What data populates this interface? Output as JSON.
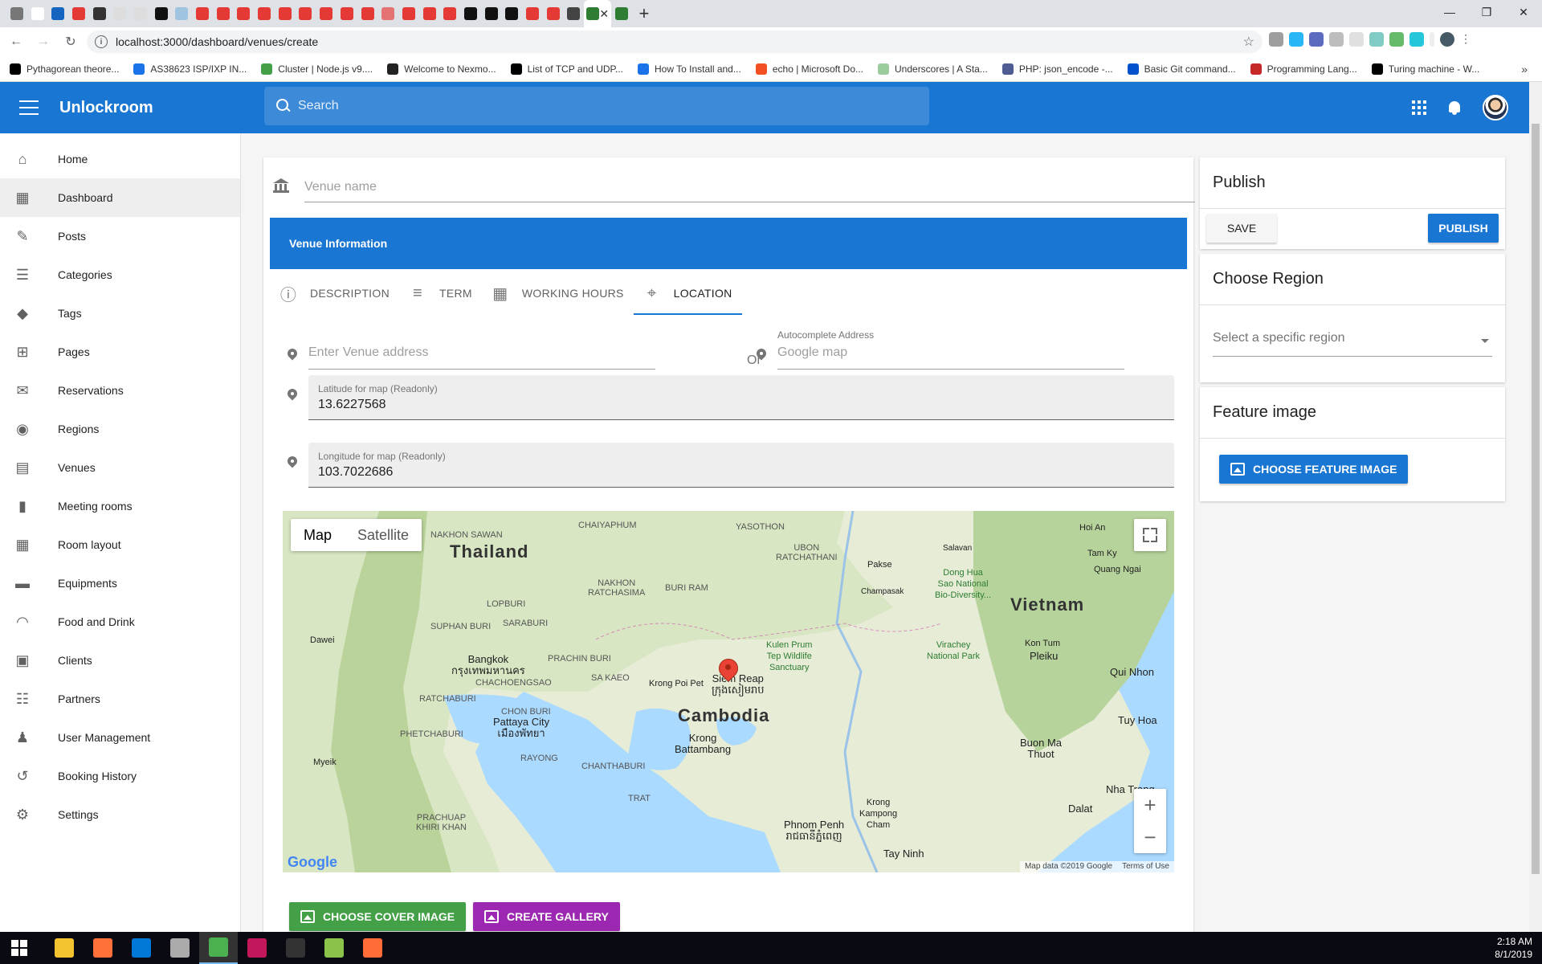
{
  "browser": {
    "url": "localhost:3000/dashboard/venues/create",
    "bookmarks": [
      {
        "label": "Pythagorean theore...",
        "icon": "wikipedia-icon",
        "color": "#000000"
      },
      {
        "label": "AS38623 ISP/IXP IN...",
        "icon": "pin-icon",
        "color": "#1a73e8"
      },
      {
        "label": "Cluster | Node.js v9....",
        "icon": "nodejs-icon",
        "color": "#43a047"
      },
      {
        "label": "Welcome to Nexmo...",
        "icon": "nexmo-icon",
        "color": "#222222"
      },
      {
        "label": "List of TCP and UDP...",
        "icon": "wikipedia-icon",
        "color": "#000000"
      },
      {
        "label": "How To Install and...",
        "icon": "digitalocean-icon",
        "color": "#1a73e8"
      },
      {
        "label": "echo | Microsoft Do...",
        "icon": "microsoft-icon",
        "color": "#f25022"
      },
      {
        "label": "Underscores | A Sta...",
        "icon": "underscores-icon",
        "color": "#9ccc9c"
      },
      {
        "label": "PHP: json_encode -...",
        "icon": "php-icon",
        "color": "#4f5b93"
      },
      {
        "label": "Basic Git command...",
        "icon": "atlassian-icon",
        "color": "#0052cc"
      },
      {
        "label": "Programming Lang...",
        "icon": "bookmark-icon",
        "color": "#c62828"
      },
      {
        "label": "Turing machine - W...",
        "icon": "wikipedia-icon",
        "color": "#000000"
      }
    ],
    "tab_favicons": [
      "#777777",
      "#ffffff",
      "#1565c0",
      "#e53935",
      "#333333",
      "#dddddd",
      "#dddddd",
      "#111111",
      "#a0c4e0",
      "#e53935",
      "#e53935",
      "#e53935",
      "#e53935",
      "#e53935",
      "#e53935",
      "#e53935",
      "#e53935",
      "#e53935",
      "#e57373",
      "#e53935",
      "#e53935",
      "#e53935",
      "#111111",
      "#111111",
      "#111111",
      "#e53935",
      "#e53935",
      "#444444",
      "#2e7d32"
    ]
  },
  "app": {
    "brand": "Unlockroom",
    "search_placeholder": "Search"
  },
  "sidebar": {
    "items": [
      {
        "label": "Home",
        "icon": "home-icon"
      },
      {
        "label": "Dashboard",
        "icon": "dashboard-icon",
        "active": true
      },
      {
        "label": "Posts",
        "icon": "pencil-icon"
      },
      {
        "label": "Categories",
        "icon": "list-icon"
      },
      {
        "label": "Tags",
        "icon": "tag-icon"
      },
      {
        "label": "Pages",
        "icon": "add-page-icon"
      },
      {
        "label": "Reservations",
        "icon": "mail-icon"
      },
      {
        "label": "Regions",
        "icon": "pin-icon"
      },
      {
        "label": "Venues",
        "icon": "building-icon"
      },
      {
        "label": "Meeting rooms",
        "icon": "door-icon"
      },
      {
        "label": "Room layout",
        "icon": "grid-icon"
      },
      {
        "label": "Equipments",
        "icon": "sofa-icon"
      },
      {
        "label": "Food and Drink",
        "icon": "cloche-icon"
      },
      {
        "label": "Clients",
        "icon": "contact-icon"
      },
      {
        "label": "Partners",
        "icon": "list-alt-icon"
      },
      {
        "label": "User Management",
        "icon": "people-icon"
      },
      {
        "label": "Booking History",
        "icon": "history-icon"
      },
      {
        "label": "Settings",
        "icon": "gear-icon"
      }
    ]
  },
  "form": {
    "venue_name_placeholder": "Venue name",
    "section_title": "Venue Information",
    "tabs": [
      {
        "label": "DESCRIPTION",
        "icon": "info-icon"
      },
      {
        "label": "TERM",
        "icon": "text-lines-icon"
      },
      {
        "label": "WORKING HOURS",
        "icon": "calendar-icon"
      },
      {
        "label": "LOCATION",
        "icon": "location-target-icon",
        "active": true
      }
    ],
    "address_placeholder": "Enter Venue address",
    "or_text": "Or",
    "autocomplete_label": "Autocomplete Address",
    "autocomplete_placeholder": "Google map",
    "latitude_label": "Latitude for map (Readonly)",
    "latitude_value": "13.6227568",
    "longitude_label": "Longitude for map (Readonly)",
    "longitude_value": "103.7022686",
    "cover_button": "CHOOSE COVER IMAGE",
    "gallery_button": "CREATE GALLERY"
  },
  "map": {
    "type_map": "Map",
    "type_satellite": "Satellite",
    "footer_data": "Map data ©2019 Google",
    "footer_terms": "Terms of Use",
    "logo": "Google",
    "countries": [
      "Thailand",
      "Cambodia",
      "Vietnam"
    ],
    "cities": [
      {
        "name": "Bangkok\nกรุงเทพมหานคร"
      },
      {
        "name": "Pattaya City\nเมืองพัทยา"
      },
      {
        "name": "Siem Reap\nក្រុងសៀមរាប"
      },
      {
        "name": "Phnom Penh\nរាជធានីភ្នំពេញ"
      },
      {
        "name": "Krong\nBattambang"
      },
      {
        "name": "Krong Poi Pet"
      },
      {
        "name": "Qui Nhon"
      },
      {
        "name": "Tuy Hoa"
      },
      {
        "name": "Buon Ma\nThuot"
      },
      {
        "name": "Nha Trang"
      },
      {
        "name": "Dalat"
      },
      {
        "name": "Tay Ninh"
      },
      {
        "name": "Pleiku"
      },
      {
        "name": "Kon Tum"
      },
      {
        "name": "Quang Ngai"
      },
      {
        "name": "Hoi An"
      },
      {
        "name": "Tam Ky"
      },
      {
        "name": "Pakse"
      },
      {
        "name": "Salavan"
      },
      {
        "name": "Champasak"
      },
      {
        "name": "Krong\nKampong\nCham"
      },
      {
        "name": "Kulen Prum\nTep Wildlife\nSanctuary"
      },
      {
        "name": "Dong Hua\nSao National\nBio-Diversity..."
      },
      {
        "name": "Virachey\nNational Park"
      },
      {
        "name": "Dawei"
      },
      {
        "name": "Myeik"
      }
    ],
    "regions": [
      "NAKHON SAWAN",
      "CHAIYAPHUM",
      "YASOTHON",
      "UBON\nRATCHATHANI",
      "NAKHON\nRATCHASIMA",
      "BURI RAM",
      "LOPBURI",
      "SUPHAN BURI",
      "SARABURI",
      "PRACHIN BURI",
      "SA KAEO",
      "CHACHOENGSAO",
      "RATCHABURI",
      "CHON BURI",
      "RAYONG",
      "CHANTHABURI",
      "TRAT",
      "PHETCHABURI",
      "PRACHUAP\nKHIRI KHAN"
    ]
  },
  "publish": {
    "title": "Publish",
    "save_label": "SAVE",
    "publish_label": "PUBLISH"
  },
  "region": {
    "title": "Choose Region",
    "placeholder": "Select a specific region"
  },
  "feature": {
    "title": "Feature image",
    "button": "CHOOSE FEATURE IMAGE"
  },
  "taskbar": {
    "time": "2:18 AM",
    "date": "8/1/2019",
    "apps": [
      {
        "icon": "file-explorer-icon",
        "color": "#f4c430"
      },
      {
        "icon": "firefox-icon",
        "color": "#ff7139"
      },
      {
        "icon": "vscode-icon",
        "color": "#0078d7"
      },
      {
        "icon": "printer-icon",
        "color": "#aaaaaa"
      },
      {
        "icon": "chrome-icon",
        "color": "#4caf50",
        "active": true
      },
      {
        "icon": "intellij-icon",
        "color": "#c2185b"
      },
      {
        "icon": "terminal-icon",
        "color": "#333333"
      },
      {
        "icon": "notepad-icon",
        "color": "#8bc34a"
      },
      {
        "icon": "postman-icon",
        "color": "#ff6c37"
      }
    ]
  },
  "colors": {
    "primary": "#1976d2",
    "cover_button": "#43a047",
    "gallery_button": "#9c27b0",
    "map_water": "#aadaff",
    "map_land": "#e8efd8"
  }
}
